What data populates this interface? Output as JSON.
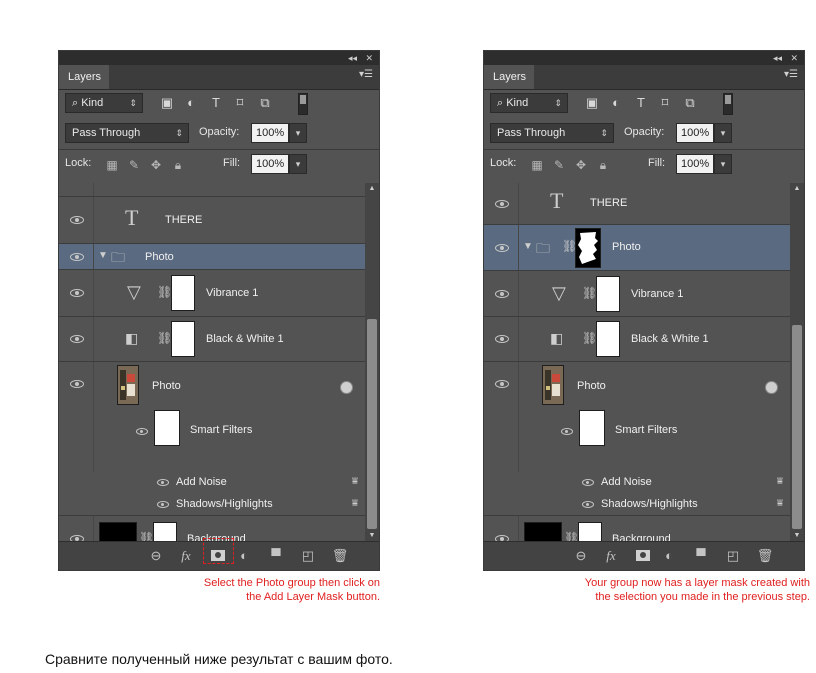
{
  "left_panel": {
    "tab_label": "Layers",
    "kind_label": "Kind",
    "blend_mode": "Pass Through",
    "opacity_label": "Opacity:",
    "opacity_value": "100%",
    "lock_label": "Lock:",
    "fill_label": "Fill:",
    "fill_value": "100%",
    "layers": {
      "there": "THERE",
      "photo_group": "Photo",
      "vibrance": "Vibrance 1",
      "bw": "Black & White 1",
      "photo": "Photo",
      "smart_filters": "Smart Filters",
      "add_noise": "Add Noise",
      "shadows": "Shadows/Highlights",
      "background": "Background"
    },
    "caption_line1": "Select the Photo group then click on",
    "caption_line2": "the Add Layer Mask button."
  },
  "right_panel": {
    "tab_label": "Layers",
    "kind_label": "Kind",
    "blend_mode": "Pass Through",
    "opacity_label": "Opacity:",
    "opacity_value": "100%",
    "lock_label": "Lock:",
    "fill_label": "Fill:",
    "fill_value": "100%",
    "layers": {
      "there": "THERE",
      "photo_group": "Photo",
      "vibrance": "Vibrance 1",
      "bw": "Black & White 1",
      "photo": "Photo",
      "smart_filters": "Smart Filters",
      "add_noise": "Add Noise",
      "shadows": "Shadows/Highlights",
      "background": "Background"
    },
    "caption_line1": "Your group now has a layer mask created with",
    "caption_line2": "the selection you made in the previous step."
  },
  "bottom_text": "Сравните полученный ниже результат с вашим фото.",
  "colors": {
    "panel_bg": "#535353",
    "selected_row": "#5a6a80",
    "caption_red": "#e02020"
  },
  "icons": [
    "eye-icon",
    "folder-icon",
    "chain-icon",
    "vibrance-icon",
    "black-white-icon",
    "fx-icon",
    "layer-mask-icon",
    "adjustment-icon",
    "new-group-icon",
    "new-layer-icon",
    "trash-icon",
    "lock-icon",
    "smart-object-icon",
    "filter-options-icon"
  ]
}
